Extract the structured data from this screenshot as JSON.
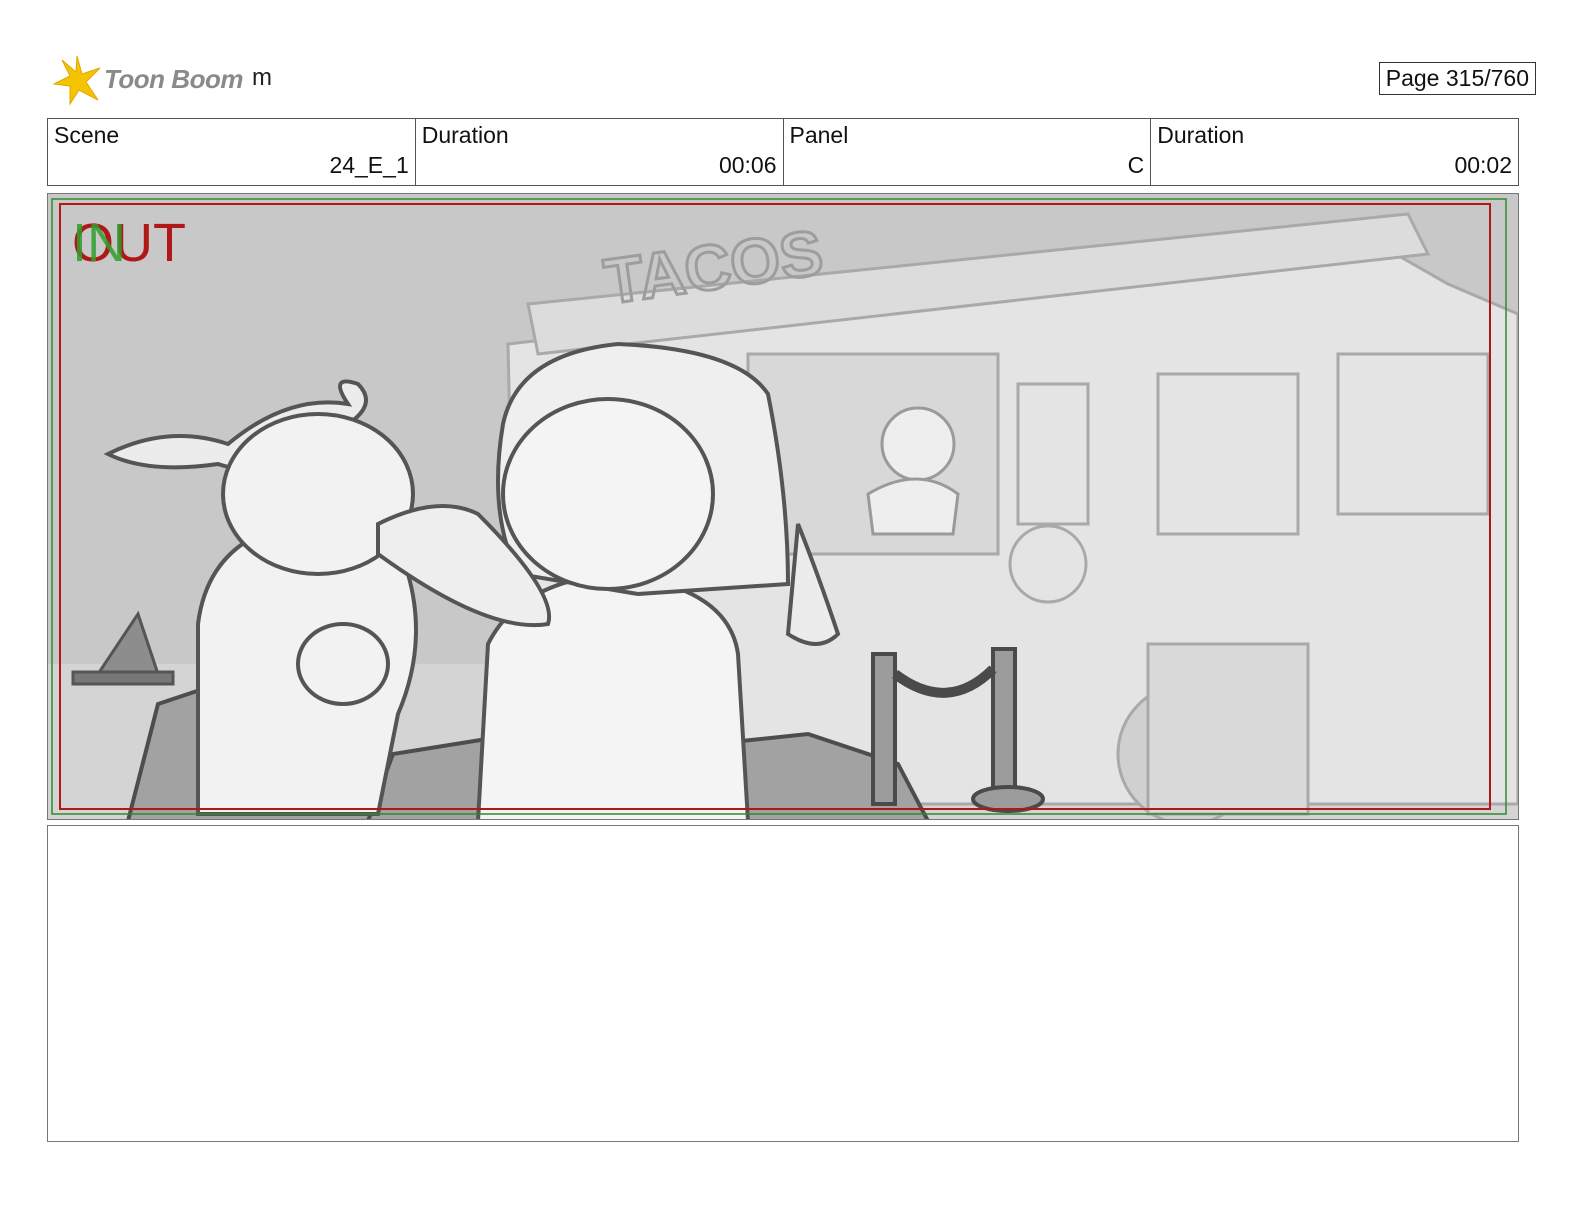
{
  "header": {
    "logo_text": "Toon Boom",
    "project_name": "m",
    "page_label": "Page 315/760"
  },
  "info": [
    {
      "label": "Scene",
      "value": "24_E_1"
    },
    {
      "label": "Duration",
      "value": "00:06"
    },
    {
      "label": "Panel",
      "value": "C"
    },
    {
      "label": "Duration",
      "value": "00:02"
    }
  ],
  "frame": {
    "out_label": "OUT",
    "in_label": "IN",
    "sign_text": "TACOS",
    "notes": ""
  },
  "colors": {
    "logo_star": "#f5c400",
    "out_red": "#b01818",
    "in_green": "#2fa02f",
    "sketch_bg": "#c9c9c9"
  }
}
